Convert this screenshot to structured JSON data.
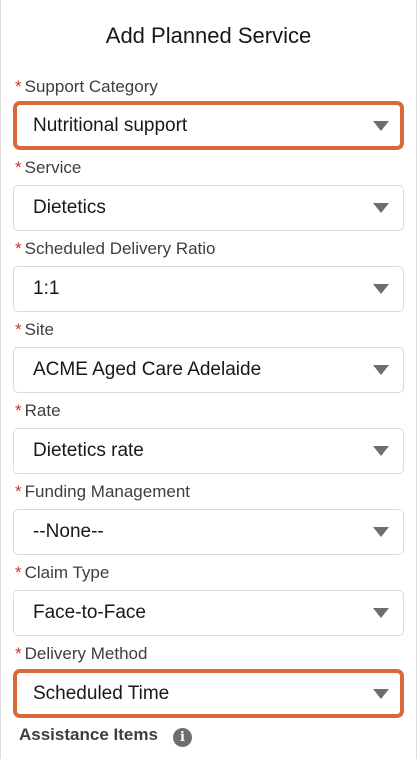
{
  "title": "Add Planned Service",
  "required_marker": "*",
  "fields": [
    {
      "label": "Support Category",
      "value": "Nutritional support",
      "highlighted": true
    },
    {
      "label": "Service",
      "value": "Dietetics",
      "highlighted": false
    },
    {
      "label": "Scheduled Delivery Ratio",
      "value": "1:1",
      "highlighted": false
    },
    {
      "label": "Site",
      "value": "ACME Aged Care Adelaide",
      "highlighted": false
    },
    {
      "label": "Rate",
      "value": "Dietetics rate",
      "highlighted": false
    },
    {
      "label": "Funding Management",
      "value": "--None--",
      "highlighted": false
    },
    {
      "label": "Claim Type",
      "value": "Face-to-Face",
      "highlighted": false
    },
    {
      "label": "Delivery Method",
      "value": "Scheduled Time",
      "highlighted": true
    }
  ],
  "assistance": {
    "label": "Assistance Items",
    "info_icon_glyph": "i",
    "icon": "info-icon"
  },
  "colors": {
    "highlight_border": "#d9683a",
    "required": "#c23934",
    "chevron": "#706e6b"
  }
}
